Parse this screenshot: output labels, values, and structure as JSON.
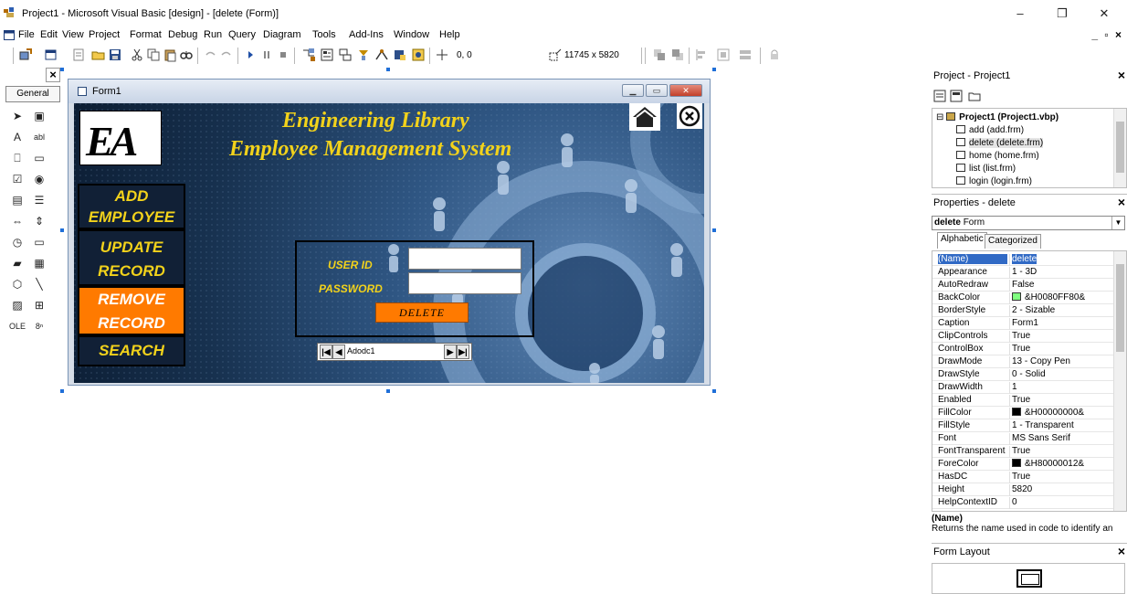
{
  "window": {
    "title": "Project1 - Microsoft Visual Basic [design] - [delete (Form)]",
    "minimize_glyph": "–",
    "maximize_glyph": "❐",
    "close_glyph": "✕",
    "mdi_controls": "_ ▫ ×"
  },
  "menu": [
    "File",
    "Edit",
    "View",
    "Project",
    "Format",
    "Debug",
    "Run",
    "Query",
    "Diagram",
    "Tools",
    "Add-Ins",
    "Window",
    "Help"
  ],
  "toolbar": {
    "position": "0, 0",
    "size": "11745 x 5820"
  },
  "toolbox": {
    "tab": "General",
    "close_glyph": "×",
    "tools": [
      {
        "glyph": "➤",
        "name": "pointer-tool"
      },
      {
        "glyph": "▣",
        "name": "picturebox-tool"
      },
      {
        "glyph": "A",
        "name": "label-tool"
      },
      {
        "glyph": "abl",
        "name": "textbox-tool"
      },
      {
        "glyph": "⎕",
        "name": "frame-tool"
      },
      {
        "glyph": "▭",
        "name": "commandbutton-tool"
      },
      {
        "glyph": "☑",
        "name": "checkbox-tool"
      },
      {
        "glyph": "◉",
        "name": "optionbutton-tool"
      },
      {
        "glyph": "▤",
        "name": "combobox-tool"
      },
      {
        "glyph": "☰",
        "name": "listbox-tool"
      },
      {
        "glyph": "⇔",
        "name": "hscrollbar-tool"
      },
      {
        "glyph": "⇕",
        "name": "vscrollbar-tool"
      },
      {
        "glyph": "◷",
        "name": "timer-tool"
      },
      {
        "glyph": "▭",
        "name": "drivelistbox-tool"
      },
      {
        "glyph": "▰",
        "name": "dirlistbox-tool"
      },
      {
        "glyph": "▦",
        "name": "filelistbox-tool"
      },
      {
        "glyph": "⬡",
        "name": "shape-tool"
      },
      {
        "glyph": "╲",
        "name": "line-tool"
      },
      {
        "glyph": "▨",
        "name": "image-tool"
      },
      {
        "glyph": "⊞",
        "name": "data-tool"
      },
      {
        "glyph": "OLE",
        "name": "ole-tool"
      },
      {
        "glyph": "8ⁿ",
        "name": "adodc-tool"
      }
    ]
  },
  "form": {
    "caption": "Form1",
    "logo": "EA",
    "heading_line1": "Engineering Library",
    "heading_line2": "Employee Management System",
    "nav": [
      {
        "line1": "ADD",
        "line2": "EMPLOYEE",
        "active": false
      },
      {
        "line1": "UPDATE",
        "line2": "RECORD",
        "active": false
      },
      {
        "line1": "REMOVE",
        "line2": "RECORD",
        "active": true
      },
      {
        "line1": "SEARCH",
        "line2": "",
        "active": false
      }
    ],
    "user_id_label": "USER ID",
    "password_label": "PASSWORD",
    "user_id_value": "",
    "password_value": "",
    "delete_button": "DELETE",
    "adodc_caption": "Adodc1",
    "colors": {
      "heading": "#f2d21b",
      "active_nav": "#ff7a00",
      "nav_bg": "#112036"
    }
  },
  "project": {
    "title": "Project - Project1",
    "root": "Project1 (Project1.vbp)",
    "files": [
      "add (add.frm)",
      "delete (delete.frm)",
      "home (home.frm)",
      "list (list.frm)",
      "login (login.frm)"
    ]
  },
  "properties": {
    "title": "Properties - delete",
    "object_name": "delete",
    "object_type": "Form",
    "tab_alphabetic": "Alphabetic",
    "tab_categorized": "Categorized",
    "rows": [
      {
        "name": "(Name)",
        "value": "delete",
        "selected": true,
        "swatch": ""
      },
      {
        "name": "Appearance",
        "value": "1 - 3D",
        "selected": false,
        "swatch": ""
      },
      {
        "name": "AutoRedraw",
        "value": "False",
        "selected": false,
        "swatch": ""
      },
      {
        "name": "BackColor",
        "value": "&H0080FF80&",
        "selected": false,
        "swatch": "#80ff80"
      },
      {
        "name": "BorderStyle",
        "value": "2 - Sizable",
        "selected": false,
        "swatch": ""
      },
      {
        "name": "Caption",
        "value": "Form1",
        "selected": false,
        "swatch": ""
      },
      {
        "name": "ClipControls",
        "value": "True",
        "selected": false,
        "swatch": ""
      },
      {
        "name": "ControlBox",
        "value": "True",
        "selected": false,
        "swatch": ""
      },
      {
        "name": "DrawMode",
        "value": "13 - Copy Pen",
        "selected": false,
        "swatch": ""
      },
      {
        "name": "DrawStyle",
        "value": "0 - Solid",
        "selected": false,
        "swatch": ""
      },
      {
        "name": "DrawWidth",
        "value": "1",
        "selected": false,
        "swatch": ""
      },
      {
        "name": "Enabled",
        "value": "True",
        "selected": false,
        "swatch": ""
      },
      {
        "name": "FillColor",
        "value": "&H00000000&",
        "selected": false,
        "swatch": "#000000"
      },
      {
        "name": "FillStyle",
        "value": "1 - Transparent",
        "selected": false,
        "swatch": ""
      },
      {
        "name": "Font",
        "value": "MS Sans Serif",
        "selected": false,
        "swatch": ""
      },
      {
        "name": "FontTransparent",
        "value": "True",
        "selected": false,
        "swatch": ""
      },
      {
        "name": "ForeColor",
        "value": "&H80000012&",
        "selected": false,
        "swatch": "#000000"
      },
      {
        "name": "HasDC",
        "value": "True",
        "selected": false,
        "swatch": ""
      },
      {
        "name": "Height",
        "value": "5820",
        "selected": false,
        "swatch": ""
      },
      {
        "name": "HelpContextID",
        "value": "0",
        "selected": false,
        "swatch": ""
      }
    ],
    "desc_name": "(Name)",
    "desc_text": "Returns the name used in code to identify an"
  },
  "form_layout": {
    "title": "Form Layout"
  }
}
